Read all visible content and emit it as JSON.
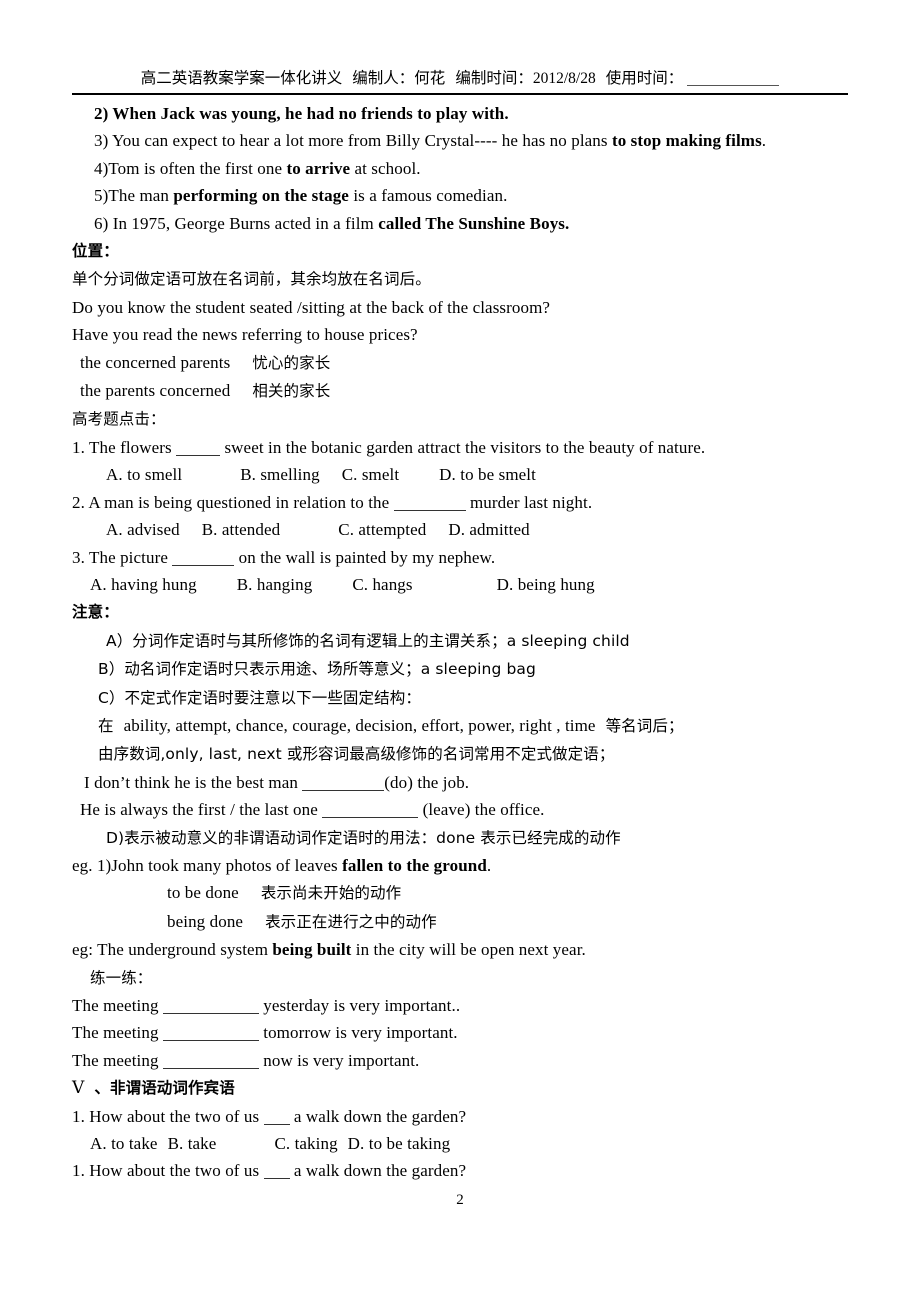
{
  "document": {
    "header": {
      "title": "高二英语教案学案一体化讲义",
      "compiler_label": "编制人：",
      "compiler_name": "何花",
      "compile_time_label": "编制时间：",
      "compile_time": "2012/8/28",
      "use_time_label": "使用时间：",
      "use_time_value": ""
    },
    "footer": {
      "page_number": "2"
    },
    "examples_group_1": [
      {
        "num": "2)",
        "pre": " When Jack was young, he had no friends ",
        "bold": "to play with.",
        "post": ""
      },
      {
        "num": "3)",
        "pre": " You can expect to hear a lot more from Billy Crystal---- he has no plans ",
        "bold": "to stop making films",
        "post": "."
      },
      {
        "num": "4)",
        "pre": "Tom is often the first one ",
        "bold": "to arrive",
        "post": " at school."
      },
      {
        "num": "5)",
        "pre": "The man ",
        "bold": "performing on the stage",
        "post": " is a famous comedian."
      },
      {
        "num": "6)",
        "pre": " In 1975, George Burns acted in a film ",
        "bold": "called The Sunshine Boys.",
        "post": ""
      }
    ],
    "position_section": {
      "heading": "位置：",
      "rule_cn": "单个分词做定语可放在名词前，其余均放在名词后。",
      "example_1": "Do you know the student seated /sitting at the back of the classroom?",
      "example_2": "Have you read the news referring to house prices?",
      "pair_1_en": "the concerned parents",
      "pair_1_cn": "忧心的家长",
      "pair_2_en": "the parents concerned",
      "pair_2_cn": "相关的家长"
    },
    "exam_section": {
      "heading": "高考题点击：",
      "questions": [
        {
          "num": "1.",
          "stem_before": " The flowers ",
          "stem_after": " sweet in the botanic garden attract the visitors to the beauty of nature.",
          "options": [
            "A. to smell",
            "B. smelling",
            "C. smelt",
            "D. to be smelt"
          ]
        },
        {
          "num": "2.",
          "stem_before": " A man is being questioned in relation to the ",
          "stem_after": " murder last night.",
          "options": [
            "A. advised",
            "B. attended",
            "C. attempted",
            "D. admitted"
          ]
        },
        {
          "num": "3.",
          "stem_before": " The picture ",
          "stem_after": " on the wall is painted by my nephew.",
          "options": [
            "A. having hung",
            "B. hanging",
            "C. hangs",
            "D. being hung"
          ]
        }
      ]
    },
    "notice_section": {
      "heading": "注意：",
      "item_a": "A）分词作定语时与其所修饰的名词有逻辑上的主谓关系；a sleeping child",
      "item_b": "B）动名词作定语时只表示用途、场所等意义；a sleeping bag",
      "item_c": "C）不定式作定语时要注意以下一些固定结构：",
      "item_c_note1_cn": "在",
      "item_c_note1_list": "ability, attempt, chance, courage, decision, effort, power, right , time",
      "item_c_note1_tail": "等名词后；",
      "item_c_note2": "由序数词,only, last, next 或形容词最高级修饰的名词常用不定式做定语；",
      "practice_1_before": "I don’t think he is the best man ",
      "practice_1_after": "(do) the job.",
      "practice_2_before": "He is always the first / the last one ",
      "practice_2_after": " (leave) the office.",
      "item_d": "D)表示被动意义的非谓语动词作定语时的用法：done  表示已经完成的动作"
    },
    "done_section": {
      "eg1_pre": "eg. 1)John took many photos of leaves ",
      "eg1_bold": "fallen to the ground",
      "eg1_post": ".",
      "to_be_done_en": "to be done",
      "to_be_done_cn": "表示尚未开始的动作",
      "being_done_en": "being done",
      "being_done_cn": "表示正在进行之中的动作",
      "eg2_pre": "eg: The underground system ",
      "eg2_bold": "being built",
      "eg2_post": " in the city will be open next year.",
      "practice_heading": "练一练："
    },
    "meeting_practice": [
      {
        "before": "The meeting ",
        "after": " yesterday is very important.."
      },
      {
        "before": "The meeting ",
        "after": " tomorrow is very important."
      },
      {
        "before": "The meeting ",
        "after": " now is very important."
      }
    ],
    "section_v": {
      "numeral": "Ⅴ",
      "heading": "、非谓语动词作宾语",
      "q1_num": "1.",
      "q1_before": " How about the two of us ",
      "q1_after": " a walk down the garden?",
      "q1_options": [
        "A. to take",
        "B. take",
        "C. taking",
        "D. to be taking"
      ],
      "q2_num": "1.",
      "q2_before": " How about the two of us ",
      "q2_after": " a walk down the garden?"
    }
  }
}
